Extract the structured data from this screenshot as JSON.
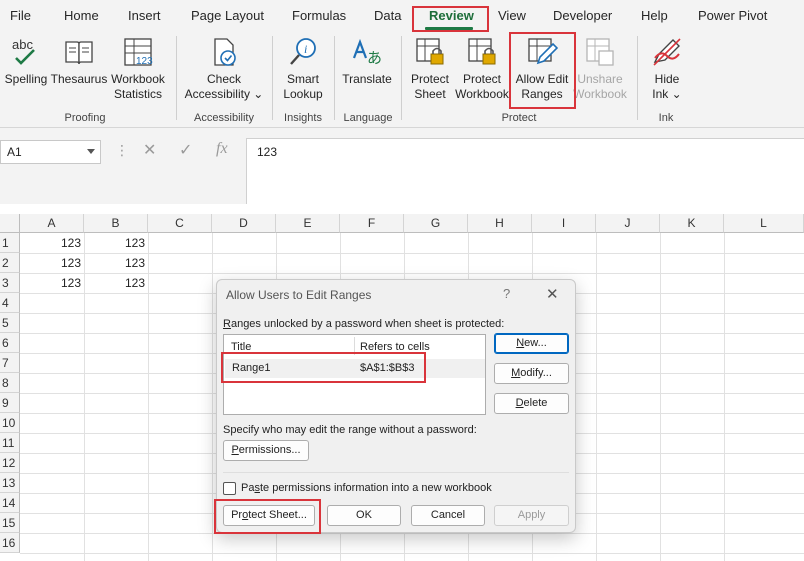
{
  "ribbon_tabs": [
    "File",
    "Home",
    "Insert",
    "Page Layout",
    "Formulas",
    "Data",
    "Review",
    "View",
    "Developer",
    "Help",
    "Power Pivot"
  ],
  "active_tab": "Review",
  "ribbon": {
    "spelling": "Spelling",
    "thesaurus": "Thesaurus",
    "workbook_statistics": [
      "Workbook",
      "Statistics"
    ],
    "check_accessibility": [
      "Check",
      "Accessibility ⌄"
    ],
    "smart_lookup": [
      "Smart",
      "Lookup"
    ],
    "translate": "Translate",
    "protect_sheet": [
      "Protect",
      "Sheet"
    ],
    "protect_workbook": [
      "Protect",
      "Workbook"
    ],
    "allow_edit_ranges": [
      "Allow Edit",
      "Ranges"
    ],
    "unshare_workbook": [
      "Unshare",
      "Workbook"
    ],
    "hide_ink": [
      "Hide",
      "Ink ⌄"
    ],
    "groups": {
      "proofing": "Proofing",
      "accessibility": "Accessibility",
      "insights": "Insights",
      "language": "Language",
      "protect": "Protect",
      "ink": "Ink"
    },
    "icon_text": {
      "spelling": "abc",
      "translate": "あ"
    }
  },
  "formula_bar": {
    "name_box": "A1",
    "cancel_symbol": "✕",
    "enter_symbol": "✓",
    "fx_symbol": "fx",
    "formula": "123"
  },
  "sheet": {
    "columns": [
      "A",
      "B",
      "C",
      "D",
      "E",
      "F",
      "G",
      "H",
      "I",
      "J",
      "K",
      "L"
    ],
    "rows": [
      "1",
      "2",
      "3",
      "4",
      "5",
      "6",
      "7",
      "8",
      "9",
      "10",
      "11",
      "12",
      "13",
      "14",
      "15",
      "16"
    ],
    "values": [
      [
        "123",
        "123"
      ],
      [
        "123",
        "123"
      ],
      [
        "123",
        "123"
      ]
    ]
  },
  "dialog": {
    "title": "Allow Users to Edit Ranges",
    "help": "?",
    "close": "✕",
    "ranges_label_first": "R",
    "ranges_label_rest": "anges unlocked by a password when sheet is protected:",
    "col_title": "Title",
    "col_refers": "Refers to cells",
    "range_title": "Range1",
    "range_ref": "$A$1:$B$3",
    "new_first": "N",
    "new_rest": "ew...",
    "modify_first": "M",
    "modify_rest": "odify...",
    "delete_first": "D",
    "delete_rest": "elete",
    "specify_label": "Specify who may edit the range without a password:",
    "permissions_first": "P",
    "permissions_rest": "ermissions...",
    "paste_label_first": "Pa",
    "paste_label_u": "s",
    "paste_label_rest": "te permissions information into a new workbook",
    "protect_sheet_first": "Pr",
    "protect_sheet_u": "o",
    "protect_sheet_rest": "tect Sheet...",
    "ok": "OK",
    "cancel": "Cancel",
    "apply": "Apply"
  },
  "colors": {
    "accent_green": "#1e7a45",
    "highlight_red": "#d9343b",
    "button_blue": "#0067c0"
  }
}
